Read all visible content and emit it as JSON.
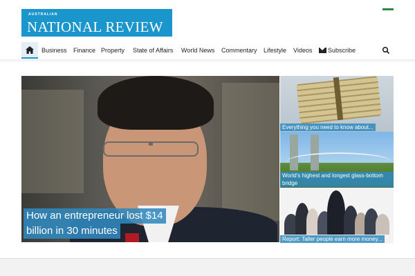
{
  "logo": {
    "small": "AUSTRALIAN",
    "name": "NATIONAL REVIEW"
  },
  "colors": {
    "brand": "#1b96cc",
    "caption": "#3089be"
  },
  "nav": {
    "home_icon": "home-icon",
    "items": [
      "Business",
      "Finance",
      "Property",
      "State of Affairs",
      "World News",
      "Commentary",
      "Lifestyle",
      "Videos"
    ],
    "subscribe": "Subscribe",
    "search_icon": "search-icon"
  },
  "hero": {
    "caption_line1": "How an entrepreneur lost $14",
    "caption_line2": "billion in 30 minutes"
  },
  "side": [
    {
      "caption": "Everything you need to know about..."
    },
    {
      "caption": "World's highest and longest glass-bottom bridge"
    },
    {
      "caption": "Report: Taller people earn more money..."
    }
  ]
}
